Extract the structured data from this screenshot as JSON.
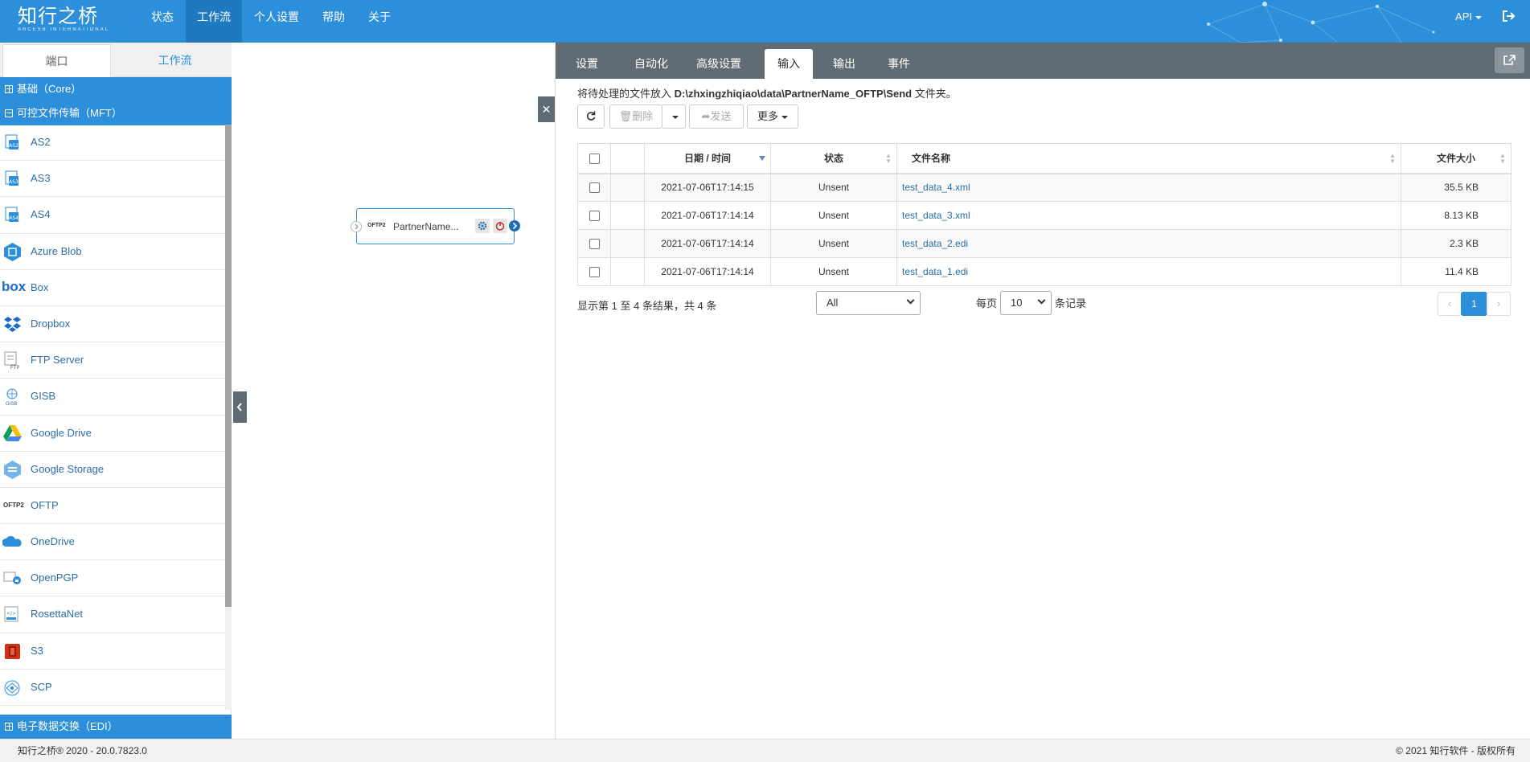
{
  "brand": {
    "name_cn": "知行之桥",
    "name_en": "ARCESB INTERNATIONAL"
  },
  "topnav": {
    "items": [
      {
        "label": "状态"
      },
      {
        "label": "工作流",
        "active": true
      },
      {
        "label": "个人设置"
      },
      {
        "label": "帮助"
      },
      {
        "label": "关于"
      }
    ],
    "api_label": "API",
    "accent": "#2d8ed9"
  },
  "left_panel": {
    "tabs": [
      {
        "label": "端口",
        "active": true
      },
      {
        "label": "工作流"
      }
    ],
    "categories": [
      {
        "label": "基础（Core）",
        "expanded": false
      },
      {
        "label": "可控文件传输（MFT）",
        "expanded": true
      },
      {
        "label": "电子数据交换（EDI）",
        "expanded": false
      }
    ],
    "connectors": [
      {
        "label": "AS2",
        "icon": "as2-icon"
      },
      {
        "label": "AS3",
        "icon": "as3-icon"
      },
      {
        "label": "AS4",
        "icon": "as4-icon"
      },
      {
        "label": "Azure Blob",
        "icon": "azure-blob-icon"
      },
      {
        "label": "Box",
        "icon": "box-icon",
        "logo_text": "box"
      },
      {
        "label": "Dropbox",
        "icon": "dropbox-icon"
      },
      {
        "label": "FTP Server",
        "icon": "ftp-server-icon",
        "logo_text": "FTP"
      },
      {
        "label": "GISB",
        "icon": "gisb-icon",
        "logo_text": "GISB"
      },
      {
        "label": "Google Drive",
        "icon": "google-drive-icon"
      },
      {
        "label": "Google Storage",
        "icon": "google-storage-icon"
      },
      {
        "label": "OFTP",
        "icon": "oftp-icon",
        "logo_text": "OFTP2"
      },
      {
        "label": "OneDrive",
        "icon": "onedrive-icon"
      },
      {
        "label": "OpenPGP",
        "icon": "openpgp-icon"
      },
      {
        "label": "RosettaNet",
        "icon": "rosettanet-icon"
      },
      {
        "label": "S3",
        "icon": "s3-icon"
      },
      {
        "label": "SCP",
        "icon": "scp-icon"
      }
    ]
  },
  "canvas": {
    "node": {
      "label": "PartnerName...",
      "tag": "OFTP2"
    }
  },
  "right_panel": {
    "tabs": [
      {
        "label": "设置"
      },
      {
        "label": "自动化"
      },
      {
        "label": "高级设置"
      },
      {
        "label": "输入",
        "active": true
      },
      {
        "label": "输出"
      },
      {
        "label": "事件"
      }
    ],
    "hint": {
      "prefix": "将待处理的文件放入",
      "path": "D:\\zhxingzhiqiao\\data\\PartnerName_OFTP\\Send",
      "suffix": "文件夹。"
    },
    "toolbar": {
      "delete_label": "删除",
      "send_label": "发送",
      "more_label": "更多"
    },
    "table": {
      "columns": [
        "日期 / 时间",
        "状态",
        "文件名称",
        "文件大小"
      ],
      "rows": [
        {
          "date": "2021-07-06T17:14:15",
          "status": "Unsent",
          "name": "test_data_4.xml",
          "size": "35.5 KB"
        },
        {
          "date": "2021-07-06T17:14:14",
          "status": "Unsent",
          "name": "test_data_3.xml",
          "size": "8.13 KB"
        },
        {
          "date": "2021-07-06T17:14:14",
          "status": "Unsent",
          "name": "test_data_2.edi",
          "size": "2.3 KB"
        },
        {
          "date": "2021-07-06T17:14:14",
          "status": "Unsent",
          "name": "test_data_1.edi",
          "size": "11.4 KB"
        }
      ]
    },
    "summary": "显示第 1 至 4 条结果，共 4 条",
    "filter_value": "All",
    "per_page_prefix": "每页",
    "per_page_value": "10",
    "per_page_suffix": "条记录",
    "pager": {
      "current": "1"
    }
  },
  "footer": {
    "version": "知行之桥® 2020 - 20.0.7823.0",
    "copyright": "© 2021 知行软件 - 版权所有"
  }
}
